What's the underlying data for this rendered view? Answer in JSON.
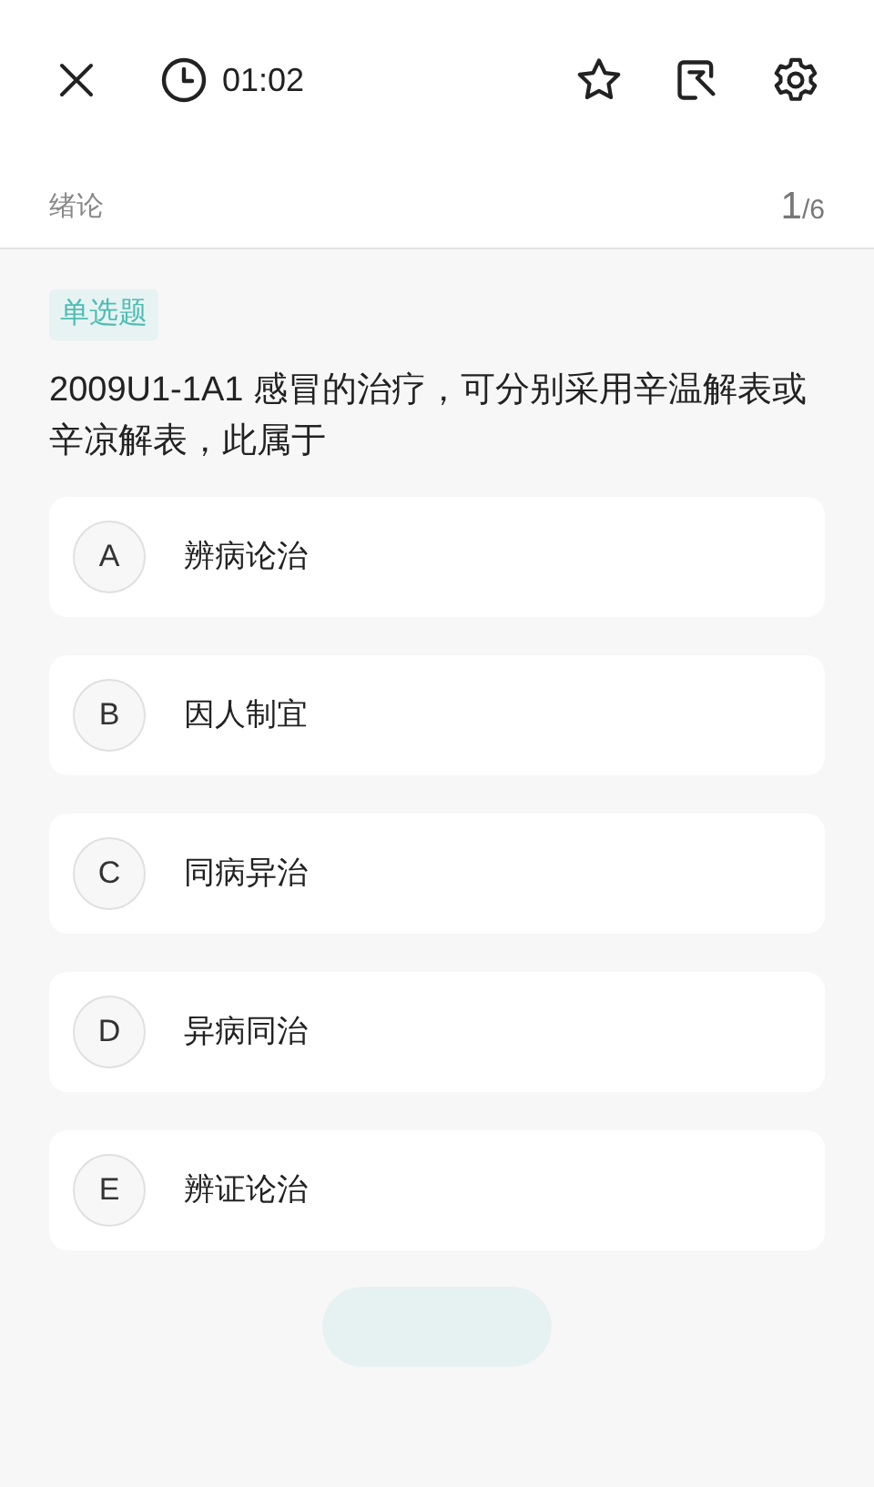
{
  "header": {
    "timer": "01:02"
  },
  "subheader": {
    "chapter": "绪论",
    "current": "1",
    "total": "/6"
  },
  "question": {
    "type_badge": "单选题",
    "text": "2009U1-1A1 感冒的治疗，可分别采用辛温解表或辛凉解表，此属于",
    "options": [
      {
        "letter": "A",
        "text": "辨病论治",
        "selected": false
      },
      {
        "letter": "B",
        "text": "因人制宜",
        "selected": false
      },
      {
        "letter": "C",
        "text": "同病异治",
        "selected": false
      },
      {
        "letter": "D",
        "text": "异病同治",
        "selected": false
      },
      {
        "letter": "E",
        "text": "辨证论治",
        "selected": false
      }
    ]
  }
}
